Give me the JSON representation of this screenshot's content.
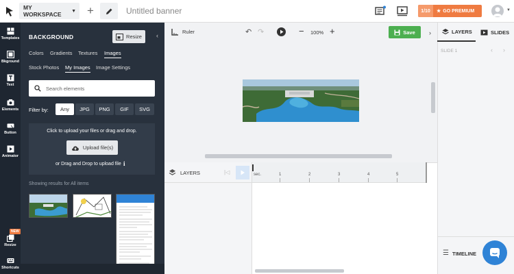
{
  "topbar": {
    "workspace_label": "MY WORKSPACE",
    "doc_title": "Untitled banner",
    "premium_count": "1/10",
    "premium_label": "GO PREMIUM"
  },
  "rail": {
    "items": [
      {
        "label": "Templates"
      },
      {
        "label": "Bkground"
      },
      {
        "label": "Text"
      },
      {
        "label": "Elements"
      },
      {
        "label": "Button"
      },
      {
        "label": "Animator"
      },
      {
        "label": "Resize"
      },
      {
        "label": "Shortcuts"
      }
    ],
    "new_badge": "NEW"
  },
  "panel": {
    "title": "BACKGROUND",
    "resize_label": "Resize",
    "tabs_row1": [
      "Colors",
      "Gradients",
      "Textures",
      "Images"
    ],
    "tabs_row2": [
      "Stock Photos",
      "My Images",
      "Image Settings"
    ],
    "search_placeholder": "Search elements",
    "filter_label": "Filter by:",
    "filters": [
      "Any",
      "JPG",
      "PNG",
      "GIF",
      "SVG"
    ],
    "upload_text": "Click to upload your files or drag and drop.",
    "upload_button": "Upload file(s)",
    "drag_text": "or Drag and Drop to upload file",
    "results_text": "Showing results for All items"
  },
  "canvas": {
    "ruler_label": "Ruler",
    "zoom": "100%",
    "save_label": "Save"
  },
  "right_panel": {
    "tab_layers": "LAYERS",
    "tab_slides": "SLIDES",
    "slide_label": "SLIDE 1",
    "timeline_label": "TIMELINE"
  },
  "timeline": {
    "layers_label": "LAYERS",
    "ruler_ticks": [
      "sec.",
      "1",
      "2",
      "3",
      "4",
      "5"
    ]
  },
  "colors": {
    "accent_green": "#4caf50",
    "premium_orange": "#ef7b41",
    "panel_dark": "#28313d",
    "chat_blue": "#2f83d6"
  }
}
